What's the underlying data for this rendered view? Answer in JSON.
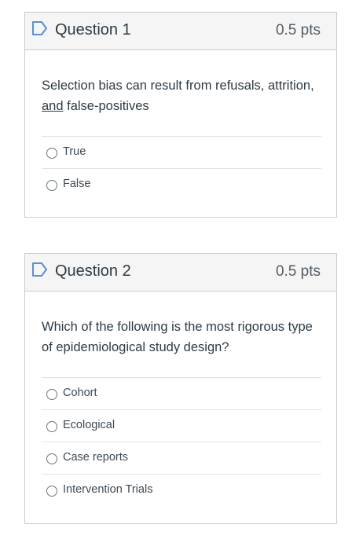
{
  "questions": [
    {
      "title": "Question 1",
      "points": "0.5 pts",
      "text_underlined": "and",
      "text_part1": "Selection bias can result from refusals, attrition,",
      "text_part2": " false-positives",
      "answers": [
        "True",
        "False"
      ]
    },
    {
      "title": "Question 2",
      "points": "0.5 pts",
      "text": "Which of the following is the most rigorous type of epidemiological study design?",
      "answers": [
        "Cohort",
        "Ecological",
        "Case reports",
        "Intervention Trials"
      ]
    }
  ],
  "icons": {
    "flag": "bookmark-flag-icon"
  },
  "colors": {
    "flag": "#5b8ed6",
    "border": "#c7cdd1",
    "header_bg": "#f5f5f5"
  }
}
